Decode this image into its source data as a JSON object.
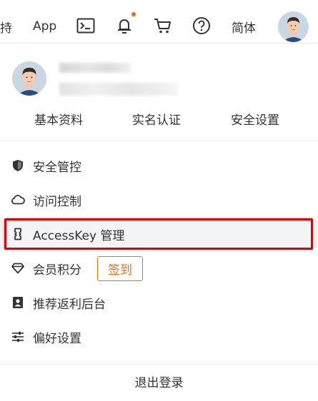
{
  "topbar": {
    "partial_label": "持",
    "app_label": "App",
    "lang_label": "简体",
    "icons": [
      "terminal-icon",
      "bell-icon",
      "cart-icon",
      "help-icon"
    ],
    "notification_dot_color": "#ff6a00"
  },
  "profile": {
    "tabs": [
      "基本资料",
      "实名认证",
      "安全设置"
    ]
  },
  "menu": {
    "items": [
      {
        "icon": "shield-icon",
        "label": "安全管控"
      },
      {
        "icon": "cloud-icon",
        "label": "访问控制"
      },
      {
        "icon": "accesskey-icon",
        "label": "AccessKey 管理"
      },
      {
        "icon": "diamond-icon",
        "label": "会员积分"
      },
      {
        "icon": "portrait-icon",
        "label": "推荐返利后台"
      },
      {
        "icon": "sliders-icon",
        "label": "偏好设置"
      }
    ],
    "signin_label": "签到"
  },
  "logout_label": "退出登录",
  "colors": {
    "accent": "#ff6a00",
    "highlight_box": "#e00000"
  }
}
